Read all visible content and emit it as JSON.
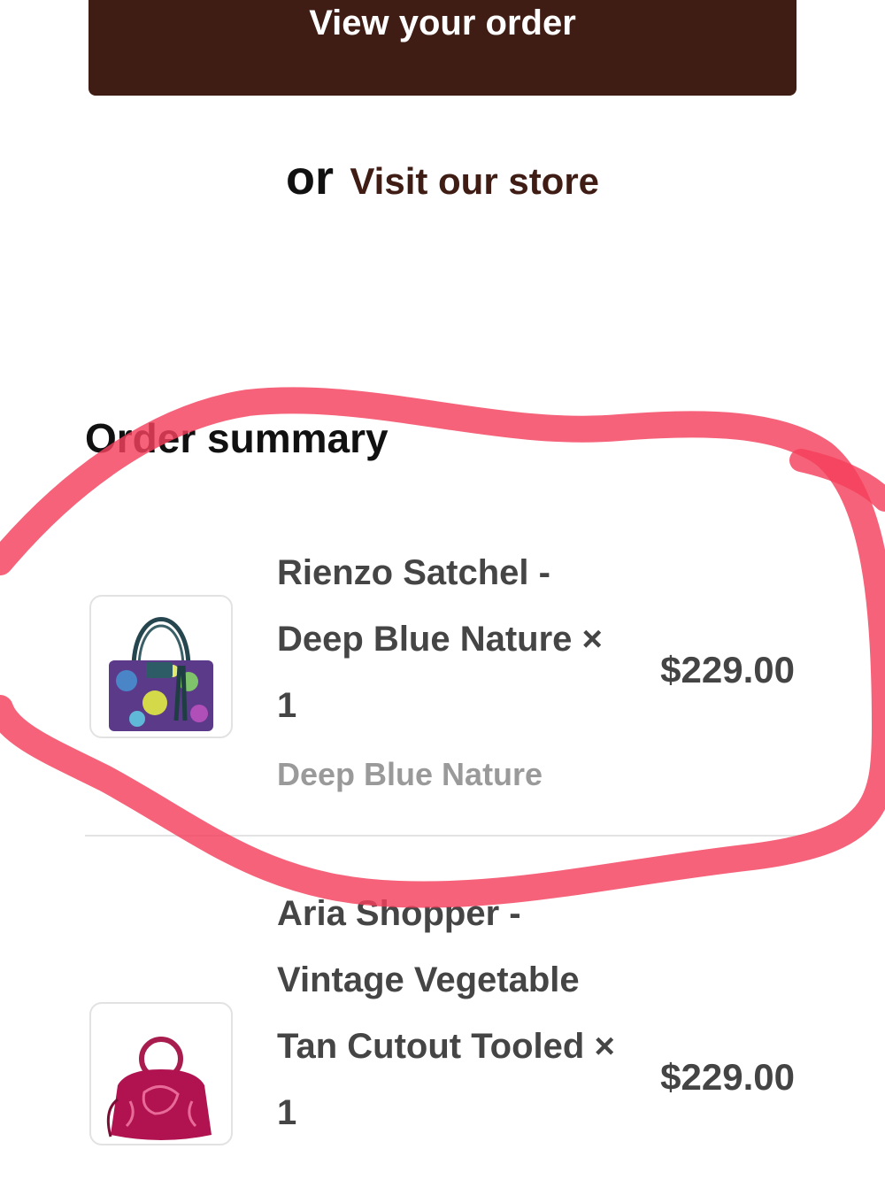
{
  "actions": {
    "view_order_label": "View your order",
    "or_label": "or",
    "visit_store_label": "Visit our store"
  },
  "order_summary": {
    "title": "Order summary",
    "items": [
      {
        "name": "Rienzo Satchel - Deep Blue Nature × 1",
        "variant": "Deep Blue Nature",
        "price": "$229.00",
        "image_icon": "handbag-floral-icon"
      },
      {
        "name": "Aria Shopper - Vintage Vegetable Tan Cutout Tooled × 1",
        "price": "$229.00",
        "image_icon": "handbag-pink-tooled-icon"
      }
    ]
  },
  "colors": {
    "primary_button": "#3f1d14",
    "annotation_stroke": "#f4405c"
  }
}
